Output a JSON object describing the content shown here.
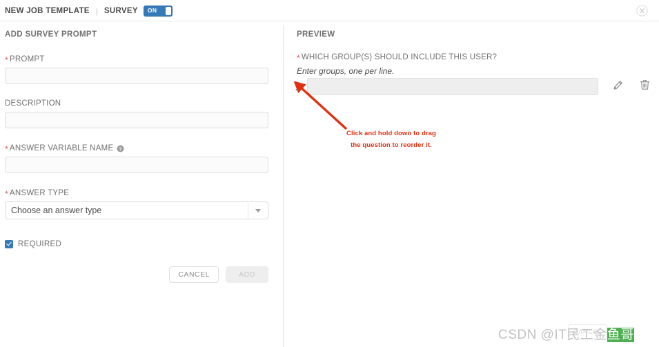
{
  "header": {
    "breadcrumb_main": "NEW JOB TEMPLATE",
    "breadcrumb_separator": "|",
    "breadcrumb_sub": "SURVEY",
    "toggle_label": "ON",
    "toggle_state": "on",
    "toggle_color": "#337ab7",
    "close_icon": "close-circle-icon"
  },
  "form": {
    "section_title": "ADD SURVEY PROMPT",
    "required_marker": "*",
    "fields": [
      {
        "label": "PROMPT",
        "required": true,
        "value": "",
        "placeholder": ""
      },
      {
        "label": "DESCRIPTION",
        "required": false,
        "value": "",
        "placeholder": ""
      },
      {
        "label": "ANSWER VARIABLE NAME",
        "required": true,
        "value": "",
        "placeholder": "",
        "help_icon": "question-circle-icon"
      }
    ],
    "answer_type": {
      "label": "ANSWER TYPE",
      "required": true,
      "selected": "Choose an answer type",
      "caret_icon": "chevron-down-icon"
    },
    "required_checkbox": {
      "label": "REQUIRED",
      "checked": true,
      "color": "#337ab7"
    },
    "buttons": {
      "cancel": "CANCEL",
      "add": "ADD",
      "add_disabled": true
    }
  },
  "preview": {
    "title": "PREVIEW",
    "question_required_marker": "*",
    "question": "WHICH GROUP(S) SHOULD INCLUDE THIS USER?",
    "hint": "Enter groups, one per line.",
    "input_value": "",
    "drag_handle_icon": "drag-handle-icon",
    "edit_icon": "pencil-icon",
    "delete_icon": "trash-icon"
  },
  "annotation": {
    "line1": "Click and hold down to drag",
    "line2": "the question to reorder it.",
    "color": "#e03010",
    "arrow_icon": "arrow-pointer-icon"
  },
  "ghost": {
    "cancel_label": "CANCEL"
  },
  "watermark": {
    "prefix": "CSDN @IT",
    "middle": "民工金",
    "highlight": "鱼哥"
  }
}
